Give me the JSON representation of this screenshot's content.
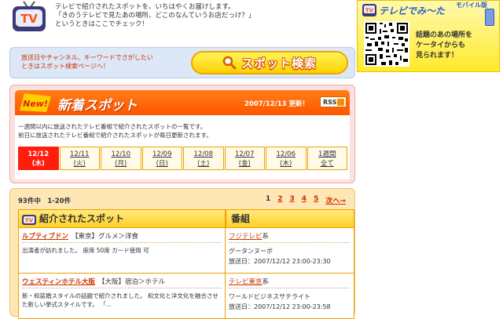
{
  "intro": {
    "logo_text": "TV",
    "lines": [
      "テレビで紹介されたスポットを、いちはやくお届けします。",
      "「きのうテレビで見たあの場所、どこのなんていうお店だっけ？」",
      "というときはここでチェック！"
    ]
  },
  "search": {
    "note_lines": [
      "放送日やチャンネル、キーワードでさがしたい",
      "ときはスポット検索ページへ！"
    ],
    "button_label": "スポット検索"
  },
  "new_spots": {
    "badge": "New!",
    "title": "新着スポット",
    "updated": "2007/12/13 更新！",
    "rss_label": "RSS",
    "desc_lines": [
      "一週間以内に放送されたテレビ番組で紹介されたスポットの一覧です。",
      "前日に放送されたテレビ番組で紹介されたスポットが毎日更新されます。"
    ],
    "dates": [
      {
        "date": "12/12",
        "day": "(木)"
      },
      {
        "date": "12/11",
        "day": "(火)"
      },
      {
        "date": "12/10",
        "day": "(月)"
      },
      {
        "date": "12/09",
        "day": "(日)"
      },
      {
        "date": "12/08",
        "day": "(土)"
      },
      {
        "date": "12/07",
        "day": "(金)"
      },
      {
        "date": "12/06",
        "day": "(木)"
      },
      {
        "date": "1週間",
        "day": "全て"
      }
    ]
  },
  "results": {
    "count": "93件中　1-20件",
    "pages": [
      "1",
      "2",
      "3",
      "4",
      "5"
    ],
    "next": "次へ→",
    "headers": {
      "spot": "紹介されたスポット",
      "program": "番組"
    },
    "rows": [
      {
        "name": "ルプティブドン",
        "category": "【東京】グルメ＞洋食",
        "desc": "出演者が訪れました。 座席 50席 カード使用 可",
        "channel": "フジテレビ",
        "channel_suffix": "系",
        "show": "グータンヌーボ",
        "airtime": "放送日：2007/12/12 23:00-23:30"
      },
      {
        "name": "ウェスティンホテル大阪",
        "category": "【大阪】宿泊＞ホテル",
        "desc": "新・和装婚スタイルの話題で紹介されました。 和文化と洋文化を融合させた新しい挙式スタイルです。 「…",
        "channel": "テレビ東京",
        "channel_suffix": "系",
        "show": "ワールドビジネスサテライト",
        "airtime": "放送日：2007/12/12 23:00-23:58"
      }
    ]
  },
  "mobile": {
    "tag": "モバイル版",
    "logo_text": "テレビでみ～た",
    "lines": [
      "話題のあの場所を",
      "ケータイからも",
      "見られます！"
    ]
  }
}
